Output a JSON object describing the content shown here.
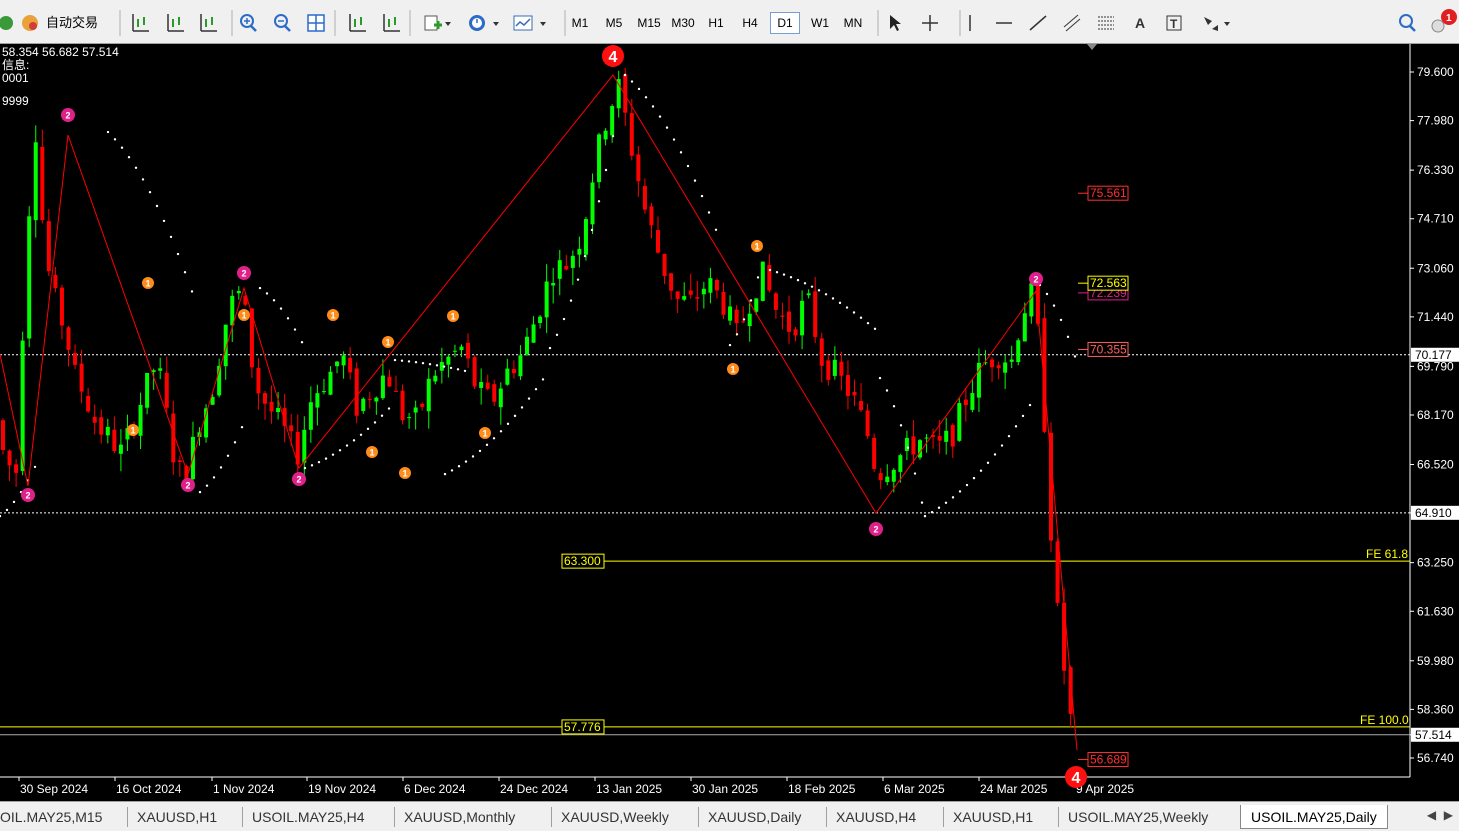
{
  "toolbar": {
    "auto_trade_label": "自动交易",
    "timeframes": [
      "M1",
      "M5",
      "M15",
      "M30",
      "H1",
      "H4",
      "D1",
      "W1",
      "MN"
    ],
    "active_timeframe": "D1",
    "notification_count": "1"
  },
  "info": {
    "ohlc_line": "58.354 56.682 57.514",
    "line2": "信息:",
    "line3": "0001",
    "line4": "9999"
  },
  "price_axis": {
    "ticks": [
      "79.600",
      "77.980",
      "76.330",
      "74.710",
      "73.060",
      "71.440",
      "69.790",
      "68.170",
      "66.520",
      "64.910",
      "63.250",
      "61.630",
      "59.980",
      "58.360",
      "57.514",
      "56.740"
    ],
    "highlight_labels": {
      "current": "70.177",
      "level": "64.910",
      "bid": "57.514"
    }
  },
  "time_axis": {
    "labels": [
      "30 Sep 2024",
      "16 Oct 2024",
      "1 Nov 2024",
      "19 Nov 2024",
      "6 Dec 2024",
      "24 Dec 2024",
      "13 Jan 2025",
      "30 Jan 2025",
      "18 Feb 2025",
      "6 Mar 2025",
      "24 Mar 2025",
      "9 Apr 2025"
    ]
  },
  "levels": {
    "fe618_label": "FE 61.8",
    "fe618_price": "63.300",
    "fe100_label": "FE 100.0",
    "fe100_price": "57.776",
    "box_75": "75.561",
    "box_72563": "72.563",
    "box_72239": "72.239",
    "box_70355": "70.355",
    "box_56": "56.689"
  },
  "wave_labels": {
    "big4": "4",
    "w1": "1",
    "w2": "2"
  },
  "tabs": [
    "OIL.MAY25,M15",
    "XAUUSD,H1",
    "USOIL.MAY25,H4",
    "XAUUSD,Monthly",
    "XAUUSD,Weekly",
    "XAUUSD,Daily",
    "XAUUSD,H4",
    "XAUUSD,H1",
    "USOIL.MAY25,Weekly",
    "USOIL.MAY25,Daily"
  ],
  "active_tab": "USOIL.MAY25,Daily",
  "colors": {
    "bull": "#00ff00",
    "bear": "#ff0000",
    "zigzag": "#ff0000",
    "psar": "#ffffff",
    "fe_line": "#ffff00",
    "wave1": "#ff8c1a",
    "wave2": "#e0208a"
  }
}
